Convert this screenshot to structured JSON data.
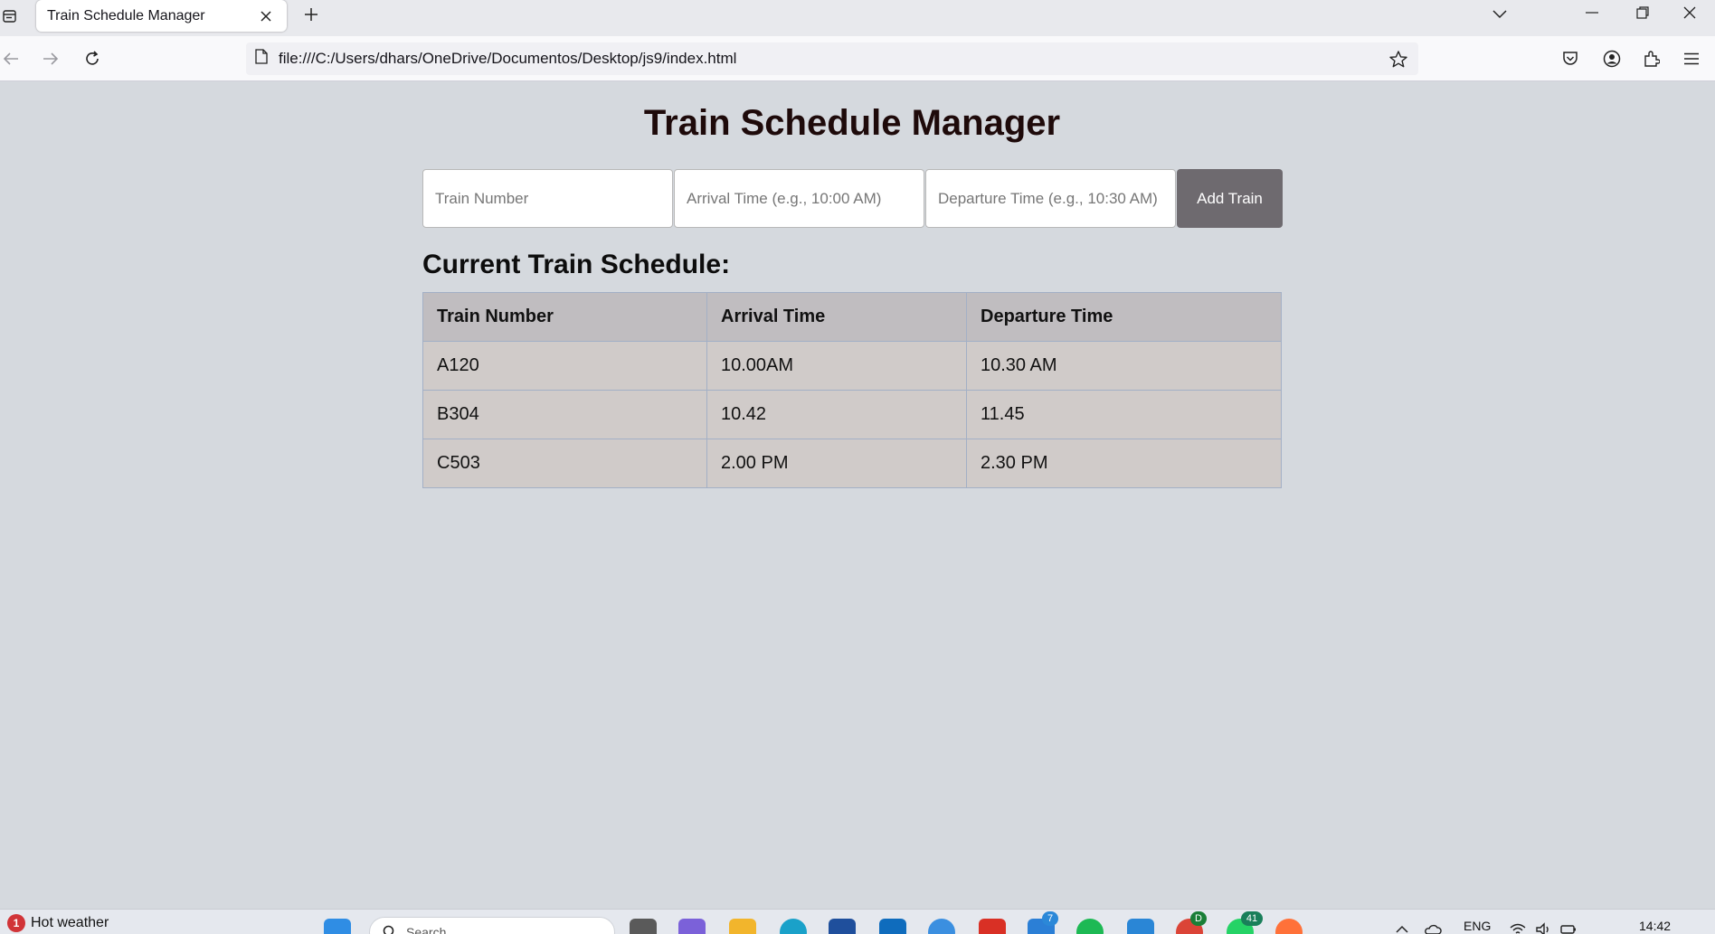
{
  "browser": {
    "tab_title": "Train Schedule Manager",
    "url": "file:///C:/Users/dhars/OneDrive/Documentos/Desktop/js9/index.html"
  },
  "page": {
    "title": "Train Schedule Manager",
    "form": {
      "train_number_placeholder": "Train Number",
      "arrival_placeholder": "Arrival Time (e.g., 10:00 AM)",
      "departure_placeholder": "Departure Time (e.g., 10:30 AM)",
      "add_button_label": "Add Train"
    },
    "schedule_heading": "Current Train Schedule:",
    "table": {
      "headers": [
        "Train Number",
        "Arrival Time",
        "Departure Time"
      ],
      "rows": [
        [
          "A120",
          "10.00AM",
          "10.30 AM"
        ],
        [
          "B304",
          "10.42",
          "11.45"
        ],
        [
          "C503",
          "2.00 PM",
          "2.30 PM"
        ]
      ]
    }
  },
  "taskbar": {
    "weather_badge": "1",
    "weather_text": "Hot weather",
    "search_placeholder": "Search",
    "badges": {
      "mail": "7",
      "whatsapp": "41",
      "chrome_profile": "D"
    },
    "language": "ENG",
    "clock": "14:42"
  },
  "colors": {
    "page_background": "#d5d9de",
    "title_color": "#1e0a0a",
    "add_button": "#6e6a6f",
    "table_header": "#c0bdc0",
    "table_cell": "#d0cbc9",
    "table_border": "#a3b0c6"
  }
}
